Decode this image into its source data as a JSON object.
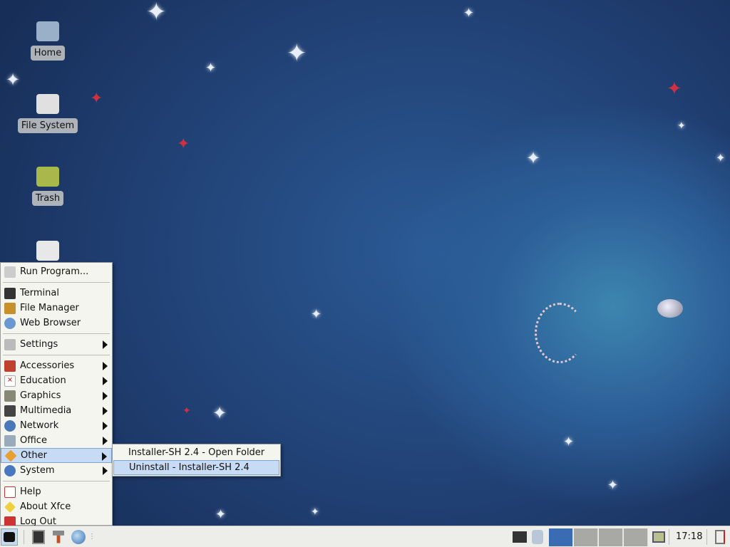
{
  "desktop_icons": [
    {
      "label": "Home"
    },
    {
      "label": "File System"
    },
    {
      "label": "Trash"
    }
  ],
  "menu": {
    "items": [
      {
        "label": "Run Program...",
        "icon": "run-icon"
      },
      {
        "label": "Terminal",
        "icon": "terminal-icon"
      },
      {
        "label": "File Manager",
        "icon": "file-manager-icon"
      },
      {
        "label": "Web Browser",
        "icon": "globe-icon"
      },
      {
        "label": "Settings",
        "icon": "settings-icon"
      },
      {
        "label": "Accessories",
        "icon": "accessories-icon"
      },
      {
        "label": "Education",
        "icon": "education-icon"
      },
      {
        "label": "Graphics",
        "icon": "graphics-icon"
      },
      {
        "label": "Multimedia",
        "icon": "multimedia-icon"
      },
      {
        "label": "Network",
        "icon": "network-icon"
      },
      {
        "label": "Office",
        "icon": "office-icon"
      },
      {
        "label": "Other",
        "icon": "other-icon"
      },
      {
        "label": "System",
        "icon": "system-icon"
      },
      {
        "label": "Help",
        "icon": "help-icon"
      },
      {
        "label": "About Xfce",
        "icon": "about-icon"
      },
      {
        "label": "Log Out",
        "icon": "logout-icon"
      }
    ]
  },
  "submenu": {
    "items": [
      {
        "label": "Installer-SH 2.4 - Open Folder"
      },
      {
        "label": "Uninstall - Installer-SH 2.4"
      }
    ]
  },
  "panel": {
    "clock": "17:18",
    "active_workspace": 1,
    "workspace_count": 4
  }
}
